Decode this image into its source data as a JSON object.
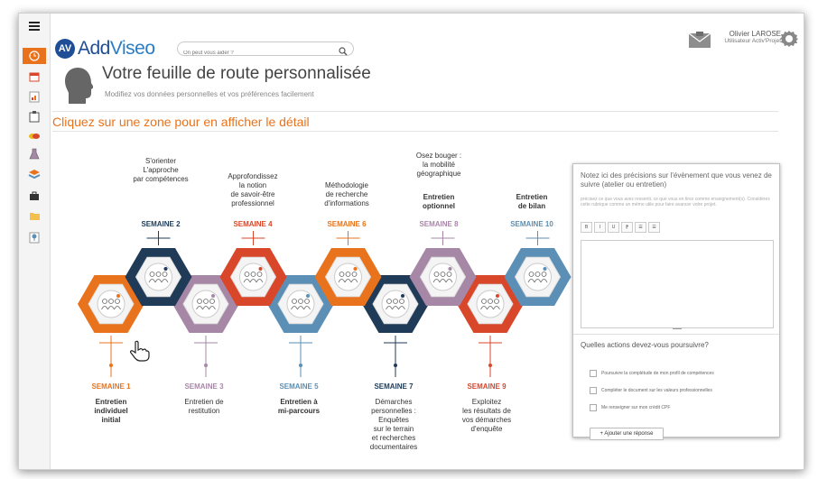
{
  "app": {
    "logo_initials": "AV",
    "logo_name_a": "Add",
    "logo_name_b": "Viseo",
    "search_placeholder": "On peut vous aider ?",
    "user_name": "Olivier LAROSE",
    "user_role": "Utilisateur Activ'Projet"
  },
  "sidebar": {
    "items": [
      "menu-icon",
      "clock-icon",
      "calendar-icon",
      "document-chart-icon",
      "clipboard-icon",
      "coins-icon",
      "flask-icon",
      "stack-icon",
      "briefcase-icon",
      "folder-icon",
      "location-pin-icon"
    ]
  },
  "header": {
    "title": "Votre feuille de route personnalisée",
    "subtitle": "Modifiez vos données personnelles et vos préférences facilement",
    "instruction": "Cliquez sur une zone pour en afficher le détail"
  },
  "weeks": [
    {
      "label": "SEMAINE 1",
      "desc": "Entretien individuel initial",
      "desc_bold": true,
      "color": "#e8731c"
    },
    {
      "label": "SEMAINE 2",
      "desc": "S'orienter L'approche par compétences",
      "desc_bold": false,
      "color": "#1f3b57"
    },
    {
      "label": "SEMAINE 3",
      "desc": "Entretien de restitution",
      "desc_bold": false,
      "color": "#a688a6"
    },
    {
      "label": "SEMAINE 4",
      "desc": "Approfondissez la notion de savoir-être professionnel",
      "desc_bold": false,
      "color": "#d9472b"
    },
    {
      "label": "SEMAINE 5",
      "desc": "Entretien à mi-parcours",
      "desc_bold": true,
      "color": "#5b8fb5"
    },
    {
      "label": "SEMAINE 6",
      "desc": "Méthodologie de recherche d'informations",
      "desc_bold": false,
      "color": "#e8731c"
    },
    {
      "label": "SEMAINE 7",
      "desc": "Démarches personnelles : Enquêtes sur le terrain et recherches documentaires",
      "desc_bold": false,
      "color": "#1f3b57"
    },
    {
      "label": "SEMAINE 8",
      "desc": "Osez bouger : la mobilité géographique Entretien optionnel",
      "desc_bold": false,
      "color": "#a688a6"
    },
    {
      "label": "SEMAINE 9",
      "desc": "Exploitez les résultats de vos démarches d'enquête",
      "desc_bold": false,
      "color": "#d9472b"
    },
    {
      "label": "SEMAINE 10",
      "desc": "Entretien de bilan",
      "desc_bold": true,
      "color": "#5b8fb5"
    }
  ],
  "week8_extra": {
    "line1": "Osez bouger :",
    "line2": "la mobilité",
    "line3": "géographique",
    "bold1": "Entretien",
    "bold2": "optionnel"
  },
  "panel": {
    "heading": "Notez ici des précisions sur l'évènement que vous venez de suivre (atelier ou entretien)",
    "help": "précisez ce que vous avez ressenti, ce que vous en tirez comme enseignement(s). Considérez cette rubrique comme un mémo utile pour faire avancer votre projet.",
    "toolbar": [
      "B",
      "I",
      "U",
      "⁋",
      "☰",
      "☰"
    ],
    "question": "Quelles actions devez-vous poursuivre?",
    "options": [
      "Poursuivre la complétude de mon profil de compétences",
      "Compléter le document sur les valeurs professionnelles",
      "Me renseigner sur mon crédit CPF"
    ],
    "add_label": "+ Ajouter une réponse"
  },
  "colors": {
    "orange": "#e8731c",
    "navy": "#1f3b57",
    "mauve": "#a688a6",
    "red": "#d9472b",
    "blue": "#5b8fb5",
    "brand": "#1f4e96"
  }
}
